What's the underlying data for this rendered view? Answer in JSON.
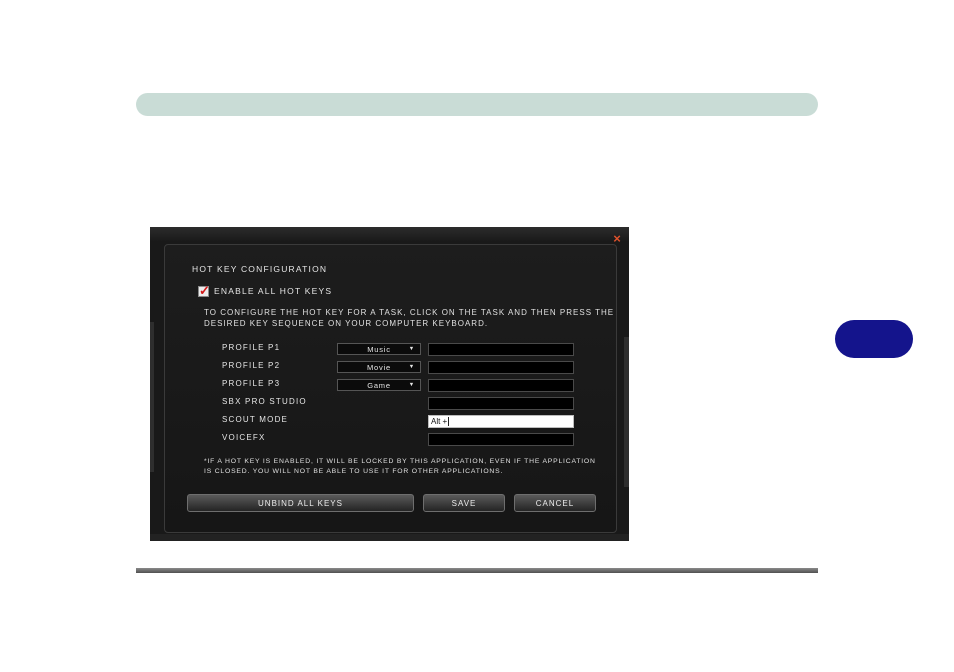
{
  "dialog": {
    "title": "Hot Key Configuration",
    "close_label": "×",
    "enable_all": {
      "label": "Enable All Hot Keys",
      "checked": true
    },
    "instructions": [
      "To configure the hot key for a task, click on the task and then press the",
      "desired key sequence on your computer keyboard."
    ],
    "rows": [
      {
        "label": "Profile P1",
        "dropdown": "Music",
        "hotkey": ""
      },
      {
        "label": "Profile P2",
        "dropdown": "Movie",
        "hotkey": ""
      },
      {
        "label": "Profile P3",
        "dropdown": "Game",
        "hotkey": ""
      },
      {
        "label": "SBX Pro Studio",
        "hotkey": ""
      },
      {
        "label": "Scout Mode",
        "hotkey": "Alt +"
      },
      {
        "label": "VoiceFX",
        "hotkey": ""
      }
    ],
    "note": [
      "*If a hot key is enabled, it will be locked by this application, even if the application",
      "is closed. You will not be able to use it for other applications."
    ],
    "buttons": {
      "unbind": "Unbind All Keys",
      "save": "Save",
      "cancel": "Cancel"
    }
  },
  "colors": {
    "header_bar": "#c9dcd6",
    "chapter_tab": "#14148c",
    "dialog_bg": "#191919",
    "close_icon": "#e0522c",
    "check_mark": "#d21a1a"
  },
  "icons": {
    "close": "close-icon",
    "check": "check-mark-icon",
    "dropdown": "chevron-down-icon"
  }
}
